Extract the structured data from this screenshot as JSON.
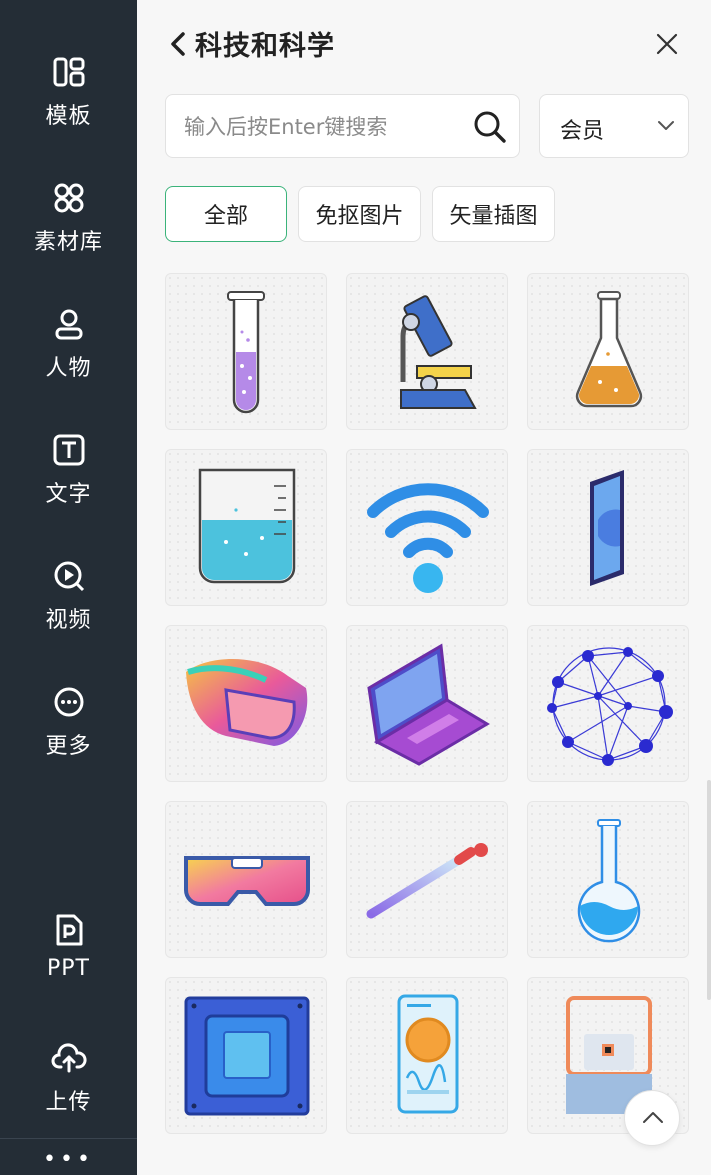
{
  "sidebar": {
    "items": [
      {
        "label": "模板",
        "icon": "template-icon"
      },
      {
        "label": "素材库",
        "icon": "material-library-icon"
      },
      {
        "label": "人物",
        "icon": "person-icon"
      },
      {
        "label": "文字",
        "icon": "text-icon"
      },
      {
        "label": "视频",
        "icon": "video-icon"
      },
      {
        "label": "更多",
        "icon": "more-icon"
      },
      {
        "label": "PPT",
        "icon": "ppt-icon"
      },
      {
        "label": "上传",
        "icon": "upload-icon"
      }
    ],
    "overflow": "•••"
  },
  "panel": {
    "title": "科技和科学",
    "search": {
      "placeholder": "输入后按Enter键搜索",
      "value": ""
    },
    "filter": {
      "selected": "会员"
    },
    "chips": [
      "全部",
      "免抠图片",
      "矢量插图"
    ],
    "active_chip": "全部"
  },
  "grid": {
    "items": [
      {
        "name": "test-tube",
        "icon": "test-tube-icon"
      },
      {
        "name": "microscope",
        "icon": "microscope-icon"
      },
      {
        "name": "flask",
        "icon": "flask-icon"
      },
      {
        "name": "beaker",
        "icon": "beaker-icon"
      },
      {
        "name": "wifi",
        "icon": "wifi-icon"
      },
      {
        "name": "smartphone",
        "icon": "smartphone-icon"
      },
      {
        "name": "vr-headset",
        "icon": "vr-headset-icon"
      },
      {
        "name": "laptop",
        "icon": "laptop-icon"
      },
      {
        "name": "network-sphere",
        "icon": "network-sphere-icon"
      },
      {
        "name": "vr-goggles",
        "icon": "vr-goggles-icon"
      },
      {
        "name": "dropper",
        "icon": "dropper-icon"
      },
      {
        "name": "round-flask",
        "icon": "round-flask-icon"
      },
      {
        "name": "cpu-chip",
        "icon": "cpu-chip-icon"
      },
      {
        "name": "phone-app",
        "icon": "phone-app-icon"
      },
      {
        "name": "device-frame",
        "icon": "device-frame-icon"
      }
    ]
  },
  "colors": {
    "sidebar_bg": "#242d36",
    "accent": "#3bb37a",
    "panel_bg": "#f7f7f7"
  }
}
